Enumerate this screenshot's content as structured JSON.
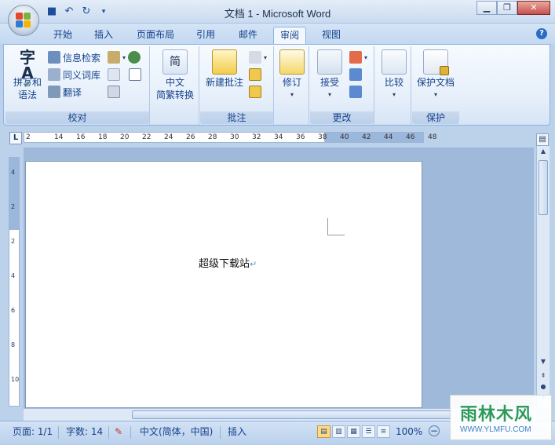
{
  "window": {
    "title": "文档 1 - Microsoft Word",
    "minimize_icon": "minimize-icon",
    "maximize_icon": "restore-icon",
    "close_icon": "close-icon"
  },
  "quick_access": {
    "items": [
      "save-icon",
      "undo-icon",
      "redo-icon",
      "customize-caret-icon"
    ]
  },
  "tabs": [
    {
      "label": "开始",
      "active": false
    },
    {
      "label": "插入",
      "active": false
    },
    {
      "label": "页面布局",
      "active": false
    },
    {
      "label": "引用",
      "active": false
    },
    {
      "label": "邮件",
      "active": false
    },
    {
      "label": "审阅",
      "active": true
    },
    {
      "label": "视图",
      "active": false
    }
  ],
  "ribbon": {
    "proofing": {
      "group_label": "校对",
      "spelling_label1": "拼写和",
      "spelling_label2": "语法",
      "research_label": "信息检索",
      "thesaurus_label": "同义词库",
      "translate_label": "翻译"
    },
    "chinese": {
      "label1": "中文",
      "label2": "简繁转换",
      "icon_text": "简"
    },
    "comments": {
      "group_label": "批注",
      "new_comment_label": "新建批注"
    },
    "tracking": {
      "track_label": "修订"
    },
    "changes": {
      "group_label": "更改",
      "accept_label": "接受"
    },
    "compare": {
      "compare_label": "比较"
    },
    "protect": {
      "group_label": "保护",
      "protect_doc_label": "保护文档"
    }
  },
  "ruler": {
    "corner": "L",
    "top_ticks": [
      "2",
      "14",
      "16",
      "18",
      "20",
      "22",
      "24",
      "26",
      "28",
      "30",
      "32",
      "34",
      "36",
      "38",
      "40",
      "42",
      "44",
      "46",
      "48"
    ],
    "left_ticks": [
      "4",
      "2",
      "2",
      "4",
      "6",
      "8",
      "10"
    ]
  },
  "document": {
    "text": "超级下载站",
    "paragraph_mark": "↵"
  },
  "status": {
    "page": "页面: 1/1",
    "words": "字数: 14",
    "language": "中文(简体，中国)",
    "insert_mode": "插入",
    "zoom": "100%",
    "zoom_out_icon": "zoom-out-icon"
  },
  "watermark": {
    "main": "雨林木风",
    "sub": "WWW.YLMFU.COM"
  },
  "colors": {
    "ribbon_bg": "#e5eefa",
    "accent": "#15428b",
    "tab_active": "#f2f7fd",
    "ruler_grey": "#9cb7dc",
    "close_red": "#c75050"
  }
}
